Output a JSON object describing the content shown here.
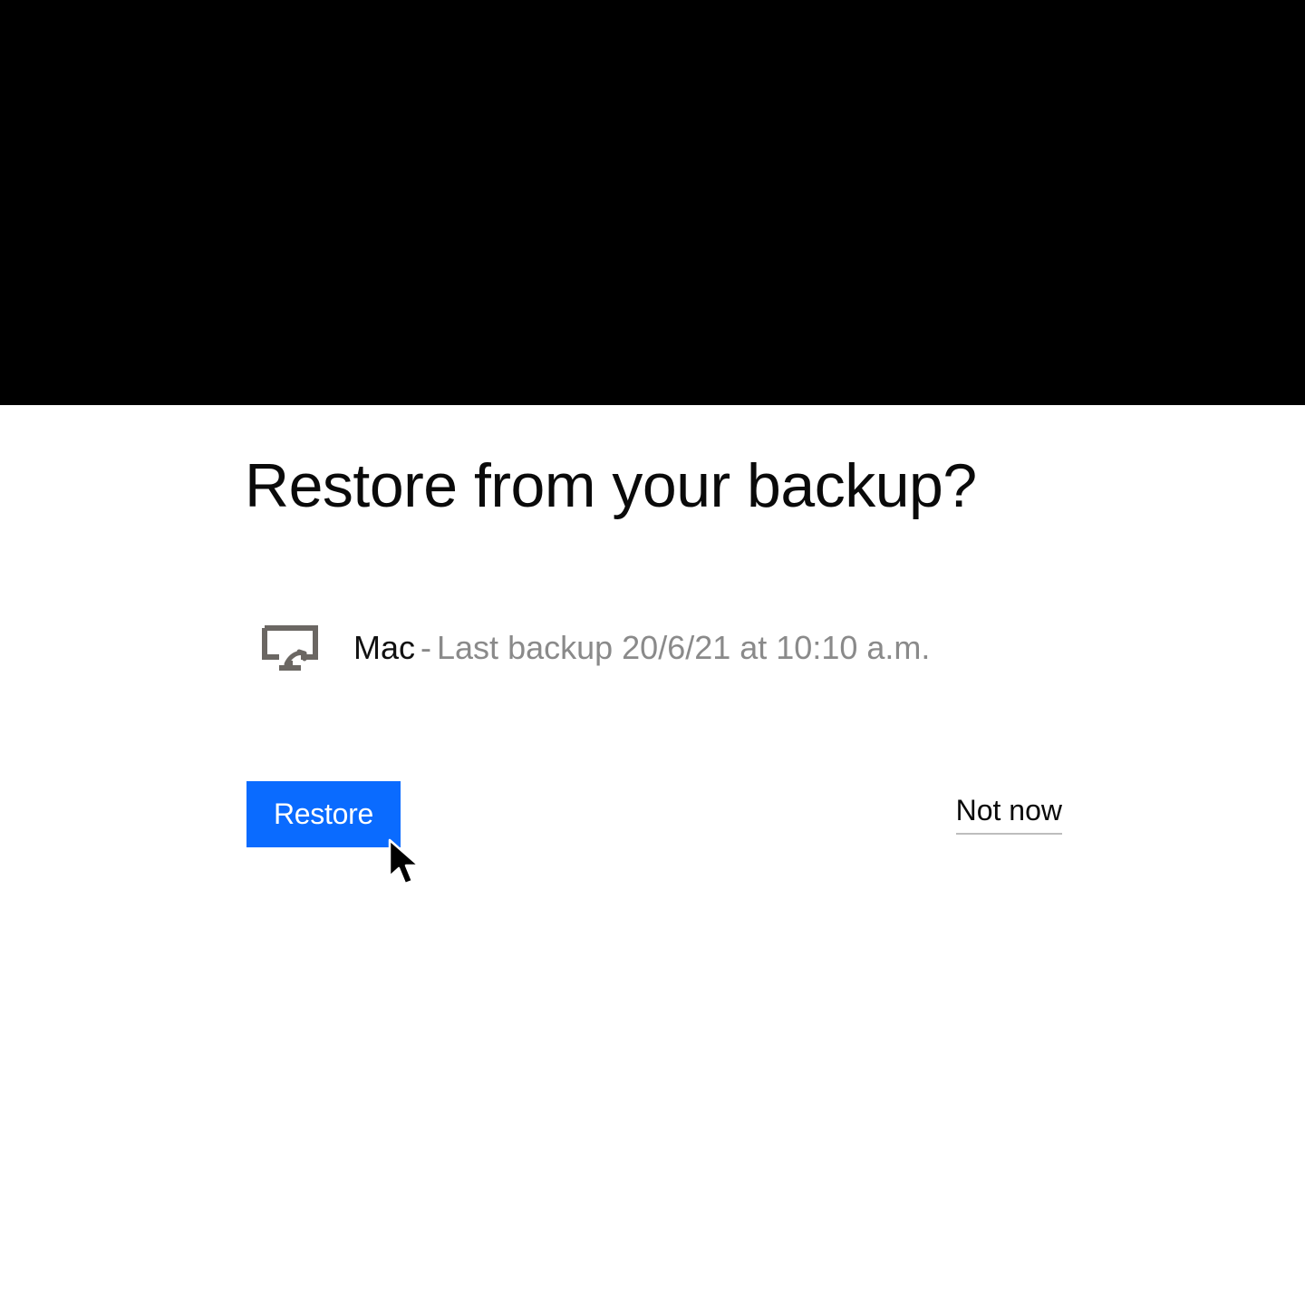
{
  "dialog": {
    "title": "Restore from your backup?",
    "device_name": "Mac",
    "separator": " - ",
    "backup_detail": "Last backup 20/6/21 at 10:10 a.m.",
    "restore_label": "Restore",
    "notnow_label": "Not now"
  },
  "colors": {
    "primary_button": "#0a6bff",
    "top_bar": "#000000",
    "muted_text": "#8a8a8a"
  }
}
